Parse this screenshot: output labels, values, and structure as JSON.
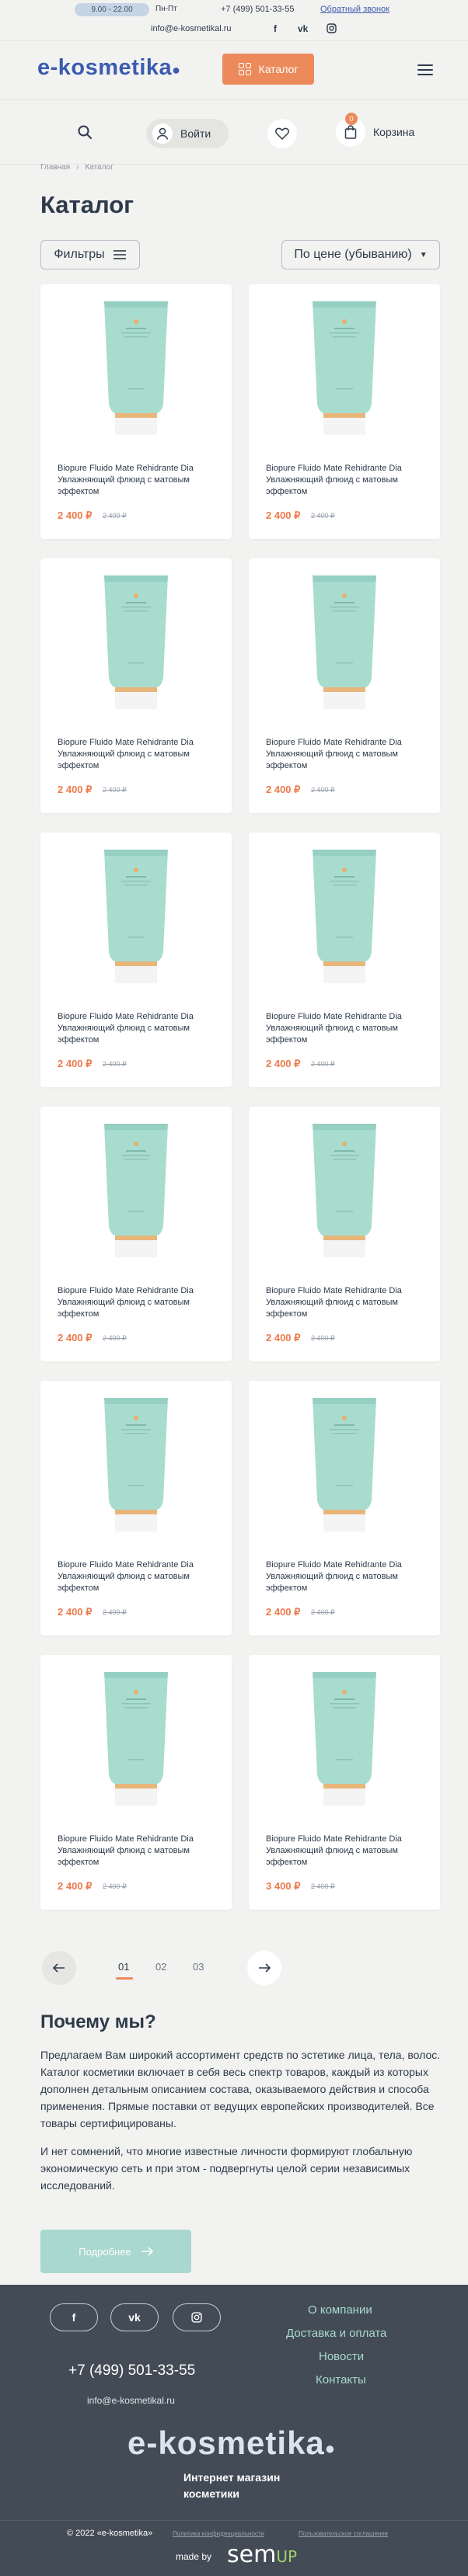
{
  "topbar": {
    "hours": "9.00 - 22.00",
    "days": "Пн-Пт",
    "phone": "+7 (499) 501-33-55",
    "callback": "Обратный звонок",
    "email": "info@e-kosmetikal.ru",
    "social": [
      "facebook-icon",
      "vk-icon",
      "instagram-icon"
    ]
  },
  "header": {
    "logo": "e-kosmetika",
    "catalog_label": "Каталог"
  },
  "nav": {
    "login_label": "Войти",
    "cart_label": "Корзина",
    "cart_count": "0"
  },
  "breadcrumb": [
    "Главная",
    "Каталог"
  ],
  "page_title": "Каталог",
  "toolbar": {
    "filters_label": "Фильтры",
    "sort_label": "По цене (убыванию)"
  },
  "products": [
    {
      "name": "Biopure Fluido Mate Rehidrante Dia Увлажняющий флюид с матовым эффектом",
      "price": "2 400 ₽",
      "old_price": "2 400 ₽"
    },
    {
      "name": "Biopure Fluido Mate Rehidrante Dia Увлажняющий флюид с матовым эффектом",
      "price": "2 400 ₽",
      "old_price": "2 400 ₽"
    },
    {
      "name": "Biopure Fluido Mate Rehidrante Dia Увлажняющий флюид с матовым эффектом",
      "price": "2 400 ₽",
      "old_price": "2 400 ₽"
    },
    {
      "name": "Biopure Fluido Mate Rehidrante Dia Увлажняющий флюид с матовым эффектом",
      "price": "2 400 ₽",
      "old_price": "2 400 ₽"
    },
    {
      "name": "Biopure Fluido Mate Rehidrante Dia Увлажняющий флюид с матовым эффектом",
      "price": "2 400 ₽",
      "old_price": "2 400 ₽"
    },
    {
      "name": "Biopure Fluido Mate Rehidrante Dia Увлажняющий флюид с матовым эффектом",
      "price": "2 400 ₽",
      "old_price": "2 400 ₽"
    },
    {
      "name": "Biopure Fluido Mate Rehidrante Dia Увлажняющий флюид с матовым эффектом",
      "price": "2 400 ₽",
      "old_price": "2 400 ₽"
    },
    {
      "name": "Biopure Fluido Mate Rehidrante Dia Увлажняющий флюид с матовым эффектом",
      "price": "2 400 ₽",
      "old_price": "2 400 ₽"
    },
    {
      "name": "Biopure Fluido Mate Rehidrante Dia Увлажняющий флюид с матовым эффектом",
      "price": "2 400 ₽",
      "old_price": "2 400 ₽"
    },
    {
      "name": "Biopure Fluido Mate Rehidrante Dia Увлажняющий флюид с матовым эффектом",
      "price": "2 400 ₽",
      "old_price": "2 400 ₽"
    },
    {
      "name": "Biopure Fluido Mate Rehidrante Dia Увлажняющий флюид с матовым эффектом",
      "price": "2 400 ₽",
      "old_price": "2 400 ₽"
    },
    {
      "name": "Biopure Fluido Mate Rehidrante Dia Увлажняющий флюид с матовым эффектом",
      "price": "3 400 ₽",
      "old_price": "2 400 ₽"
    }
  ],
  "pagination": {
    "pages": [
      "01",
      "02",
      "03"
    ],
    "active": "01"
  },
  "why": {
    "title": "Почему мы?",
    "p1": "Предлагаем Вам широкий ассортимент средств по эстетике лица, тела, волос. Каталог косметики включает в себя весь спектр товаров, каждый из которых дополнен детальным описанием состава, оказываемого действия и способа применения. Прямые поставки от ведущих европейских производителей. Все товары сертифицированы.",
    "p2": "И нет сомнений, что многие известные личности формируют глобальную экономическую сеть и при этом - подвергнуты целой серии независимых исследований.",
    "more_label": "Подробнее"
  },
  "footer": {
    "phone": "+7 (499) 501-33-55",
    "email": "info@e-kosmetikal.ru",
    "links": [
      "О компании",
      "Доставка и оплата",
      "Новости",
      "Контакты"
    ],
    "logo": "e-kosmetika",
    "tagline": "Интернет магазин косметики",
    "copyright": "© 2022 «e-kosmetika»",
    "privacy": "Политика конфиденциальности",
    "agreement": "Пользовательское соглашение",
    "made_by": "made by",
    "dev_logo": "sem",
    "dev_logo_accent": "UP"
  },
  "colors": {
    "brand": "#3b5bb0",
    "accent": "#ec8a5c",
    "mint": "#a9d8cf",
    "footer_bg": "#434c56"
  }
}
